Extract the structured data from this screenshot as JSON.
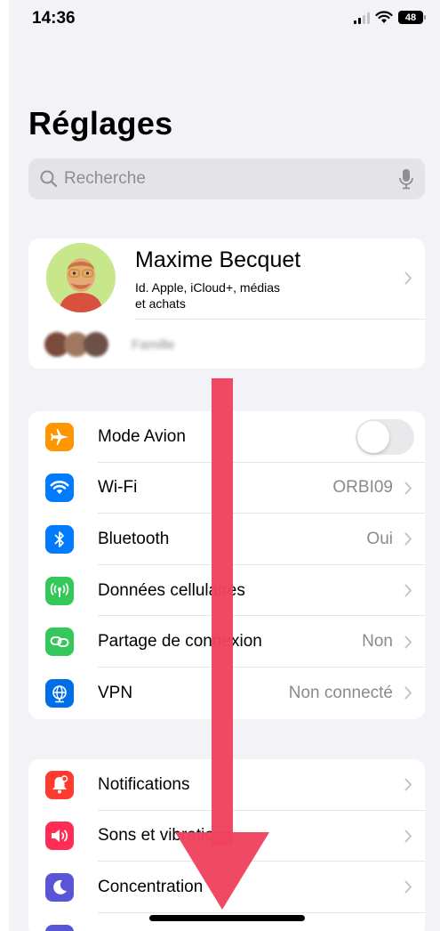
{
  "status_bar": {
    "time": "14:36",
    "battery": "48",
    "icons": [
      "cellular-signal-icon",
      "wifi-icon",
      "battery-icon"
    ]
  },
  "page": {
    "title": "Réglages"
  },
  "search": {
    "placeholder": "Recherche",
    "icons": [
      "search-icon",
      "microphone-icon"
    ]
  },
  "profile": {
    "name": "Maxime Becquet",
    "subtitle_line1": "Id. Apple, iCloud+, médias",
    "subtitle_line2": "et achats",
    "family_label": "Famille"
  },
  "connectivity": [
    {
      "label": "Mode Avion",
      "value": "",
      "icon": "airplane-icon",
      "color": "#ff9500",
      "toggle": false
    },
    {
      "label": "Wi-Fi",
      "value": "ORBI09",
      "icon": "wifi-icon",
      "color": "#007aff"
    },
    {
      "label": "Bluetooth",
      "value": "Oui",
      "icon": "bluetooth-icon",
      "color": "#007aff"
    },
    {
      "label": "Données cellulaires",
      "value": "",
      "icon": "cellular-antenna-icon",
      "color": "#34c759"
    },
    {
      "label": "Partage de connexion",
      "value": "Non",
      "icon": "personal-hotspot-icon",
      "color": "#34c759"
    },
    {
      "label": "VPN",
      "value": "Non connecté",
      "icon": "globe-icon",
      "color": "#006ee6"
    }
  ],
  "notifications": [
    {
      "label": "Notifications",
      "icon": "bell-icon",
      "color": "#ff3b30"
    },
    {
      "label": "Sons et vibrations",
      "icon": "speaker-icon",
      "color": "#ff2d55"
    },
    {
      "label": "Concentration",
      "icon": "moon-icon",
      "color": "#5856d6"
    }
  ],
  "overlay": {
    "arrow_color": "#f0435f",
    "icon": "down-arrow-icon"
  }
}
